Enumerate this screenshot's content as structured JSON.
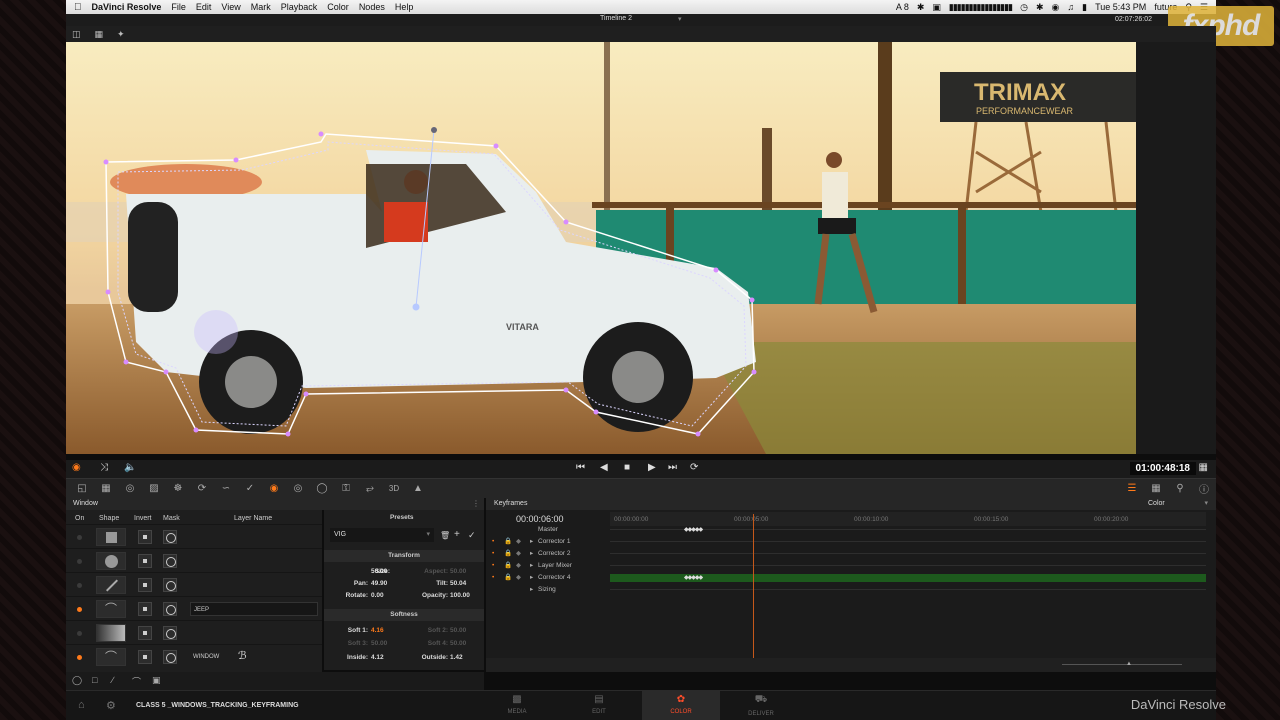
{
  "menubar": {
    "app_name": "DaVinci Resolve",
    "menus": [
      "File",
      "Edit",
      "View",
      "Mark",
      "Playback",
      "Color",
      "Nodes",
      "Help"
    ],
    "status_a": "A 8",
    "status_b": "Tue 5:43 PM",
    "user": "future"
  },
  "titlebar": {
    "timeline": "Timeline 2",
    "timecode": "02:07:26:02"
  },
  "watermark": "fxphd",
  "viewer": {
    "billboard_title": "TRIMAX",
    "billboard_sub": "PERFORMANCEWEAR",
    "car_badge": "VITARA"
  },
  "transport": {
    "timecode": "01:00:48:18"
  },
  "window_panel": {
    "title": "Window",
    "col_on": "On",
    "col_shape": "Shape",
    "col_invert": "Invert",
    "col_mask": "Mask",
    "col_layer": "Layer Name",
    "rows": [
      {
        "name": "",
        "on": false
      },
      {
        "name": "",
        "on": false
      },
      {
        "name": "",
        "on": false
      },
      {
        "name": "JEEP",
        "on": true
      },
      {
        "name": "",
        "on": false
      },
      {
        "name": "WINDOW",
        "on": true
      }
    ]
  },
  "inspector": {
    "presets_label": "Presets",
    "preset_value": "VIG",
    "transform_label": "Transform",
    "size_label": "Size:",
    "size_value": "50.00",
    "aspect_label": "Aspect:",
    "aspect_value": "50.00",
    "pan_label": "Pan:",
    "pan_value": "49.90",
    "tilt_label": "Tilt:",
    "tilt_value": "50.04",
    "rotate_label": "Rotate:",
    "rotate_value": "0.00",
    "opacity_label": "Opacity:",
    "opacity_value": "100.00",
    "softness_label": "Softness",
    "soft1_label": "Soft 1:",
    "soft1_value": "4.16",
    "soft2_label": "Soft 2:",
    "soft2_value": "50.00",
    "soft3_label": "Soft 3:",
    "soft3_value": "50.00",
    "soft4_label": "Soft 4:",
    "soft4_value": "50.00",
    "inside_label": "Inside:",
    "inside_value": "4.12",
    "outside_label": "Outside:",
    "outside_value": "1.42"
  },
  "keyframes": {
    "title": "Keyframes",
    "mode": "Color",
    "timecode": "00:00:06:00",
    "ruler": [
      "00:00:00:00",
      "00:00:05:00",
      "00:00:10:00",
      "00:00:15:00",
      "00:00:20:00"
    ],
    "tracks": [
      "Master",
      "Corrector 1",
      "Corrector 2",
      "Layer Mixer",
      "Corrector 4",
      "Sizing"
    ]
  },
  "bottombar": {
    "project": "CLASS 5 _WINDOWS_TRACKING_KEYFRAMING",
    "pages": [
      "MEDIA",
      "EDIT",
      "COLOR",
      "DELIVER"
    ],
    "brand": "DaVinci Resolve"
  },
  "colors": {
    "accent": "#ff7a1a",
    "color_page": "#ff4d2a"
  }
}
